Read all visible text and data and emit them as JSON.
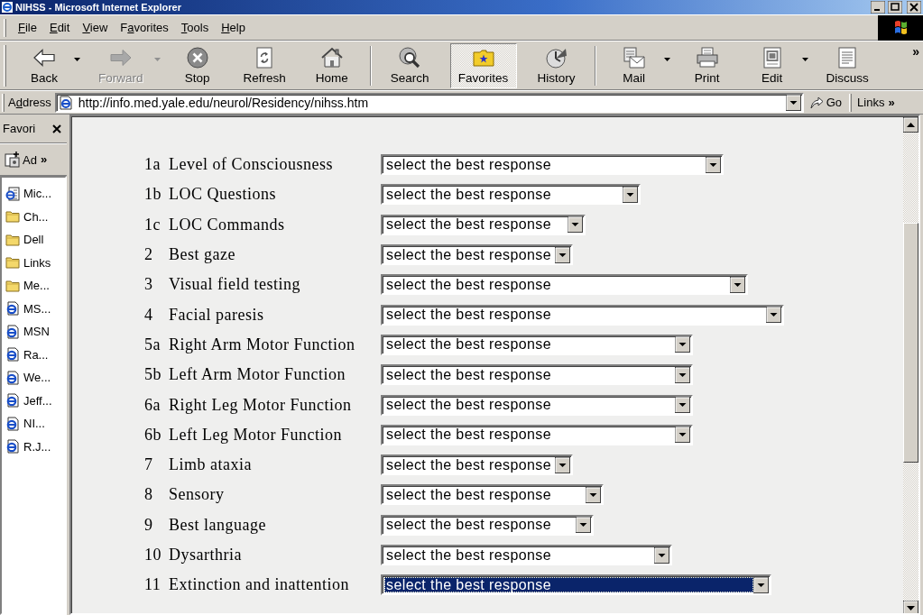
{
  "window": {
    "title": "NIHSS - Microsoft Internet Explorer"
  },
  "menu": [
    {
      "key": "F",
      "post": "ile"
    },
    {
      "key": "E",
      "post": "dit"
    },
    {
      "key": "V",
      "post": "iew"
    },
    {
      "pre": "F",
      "key": "a",
      "post": "vorites"
    },
    {
      "key": "T",
      "post": "ools"
    },
    {
      "key": "H",
      "post": "elp"
    }
  ],
  "toolbar": {
    "groups": [
      [
        {
          "kind": "back",
          "label": "Back",
          "disabled": false,
          "selected": false,
          "dropdown": true
        },
        {
          "kind": "forward",
          "label": "Forward",
          "disabled": true,
          "selected": false,
          "dropdown": true
        },
        {
          "kind": "stop",
          "label": "Stop",
          "disabled": false,
          "selected": false,
          "dropdown": false
        },
        {
          "kind": "refresh",
          "label": "Refresh",
          "disabled": false,
          "selected": false,
          "dropdown": false
        },
        {
          "kind": "home",
          "label": "Home",
          "disabled": false,
          "selected": false,
          "dropdown": false
        }
      ],
      [
        {
          "kind": "search",
          "label": "Search",
          "disabled": false,
          "selected": false,
          "dropdown": false
        },
        {
          "kind": "favorites",
          "label": "Favorites",
          "disabled": false,
          "selected": true,
          "dropdown": false
        },
        {
          "kind": "history",
          "label": "History",
          "disabled": false,
          "selected": false,
          "dropdown": false
        }
      ],
      [
        {
          "kind": "mail",
          "label": "Mail",
          "disabled": false,
          "selected": false,
          "dropdown": true
        },
        {
          "kind": "print",
          "label": "Print",
          "disabled": false,
          "selected": false,
          "dropdown": false
        },
        {
          "kind": "edit",
          "label": "Edit",
          "disabled": false,
          "selected": false,
          "dropdown": true
        },
        {
          "kind": "discuss",
          "label": "Discuss",
          "disabled": false,
          "selected": false,
          "dropdown": false
        }
      ]
    ],
    "overflow": "»"
  },
  "address_bar": {
    "label": {
      "pre": "A",
      "key": "d",
      "post": "dress"
    },
    "url": "http://info.med.yale.edu/neurol/Residency/nihss.htm",
    "go": "Go",
    "links": "Links",
    "links_overflow": "»"
  },
  "favorites_panel": {
    "title": "Favori",
    "add_label": "Ad",
    "add_overflow": "»",
    "items": [
      {
        "kind": "document",
        "label": "Mic..."
      },
      {
        "kind": "folder",
        "label": "Ch..."
      },
      {
        "kind": "folder",
        "label": "Dell"
      },
      {
        "kind": "folder",
        "label": "Links"
      },
      {
        "kind": "folder",
        "label": "Me..."
      },
      {
        "kind": "link",
        "label": "MS..."
      },
      {
        "kind": "link",
        "label": "MSN"
      },
      {
        "kind": "link",
        "label": "Ra..."
      },
      {
        "kind": "link",
        "label": "We..."
      },
      {
        "kind": "link",
        "label": "Jeff..."
      },
      {
        "kind": "link",
        "label": "NI..."
      },
      {
        "kind": "link",
        "label": "R.J..."
      }
    ]
  },
  "form": {
    "rows": [
      {
        "number": "1a",
        "label": "Level of Consciousness",
        "select": {
          "value": "select the best response",
          "focused": false
        }
      },
      {
        "number": "1b",
        "label": "LOC Questions",
        "select": {
          "value": "select the best response",
          "focused": false
        }
      },
      {
        "number": "1c",
        "label": "LOC Commands",
        "select": {
          "value": "select the best response",
          "focused": false
        }
      },
      {
        "number": "2",
        "label": "Best gaze",
        "select": {
          "value": "select the best response",
          "focused": false
        }
      },
      {
        "number": "3",
        "label": "Visual field testing",
        "select": {
          "value": "select the best response",
          "focused": false
        }
      },
      {
        "number": "4",
        "label": "Facial paresis",
        "select": {
          "value": "select the best response",
          "focused": false
        }
      },
      {
        "number": "5a",
        "label": "Right Arm Motor Function",
        "select": {
          "value": "select the best response",
          "focused": false
        }
      },
      {
        "number": "5b",
        "label": "Left Arm Motor Function",
        "select": {
          "value": "select the best response",
          "focused": false
        }
      },
      {
        "number": "6a",
        "label": "Right Leg Motor Function",
        "select": {
          "value": "select the best response",
          "focused": false
        }
      },
      {
        "number": "6b",
        "label": "Left Leg Motor Function",
        "select": {
          "value": "select the best response",
          "focused": false
        }
      },
      {
        "number": "7",
        "label": "Limb ataxia",
        "select": {
          "value": "select the best response",
          "focused": false
        }
      },
      {
        "number": "8",
        "label": "Sensory",
        "select": {
          "value": "select the best response",
          "focused": false
        }
      },
      {
        "number": "9",
        "label": "Best language",
        "select": {
          "value": "select the best response",
          "focused": false
        }
      },
      {
        "number": "10",
        "label": "Dysarthria",
        "select": {
          "value": "select the best response",
          "focused": false
        }
      },
      {
        "number": "11",
        "label": "Extinction and inattention",
        "select": {
          "value": "select the best response",
          "focused": true
        }
      }
    ]
  }
}
